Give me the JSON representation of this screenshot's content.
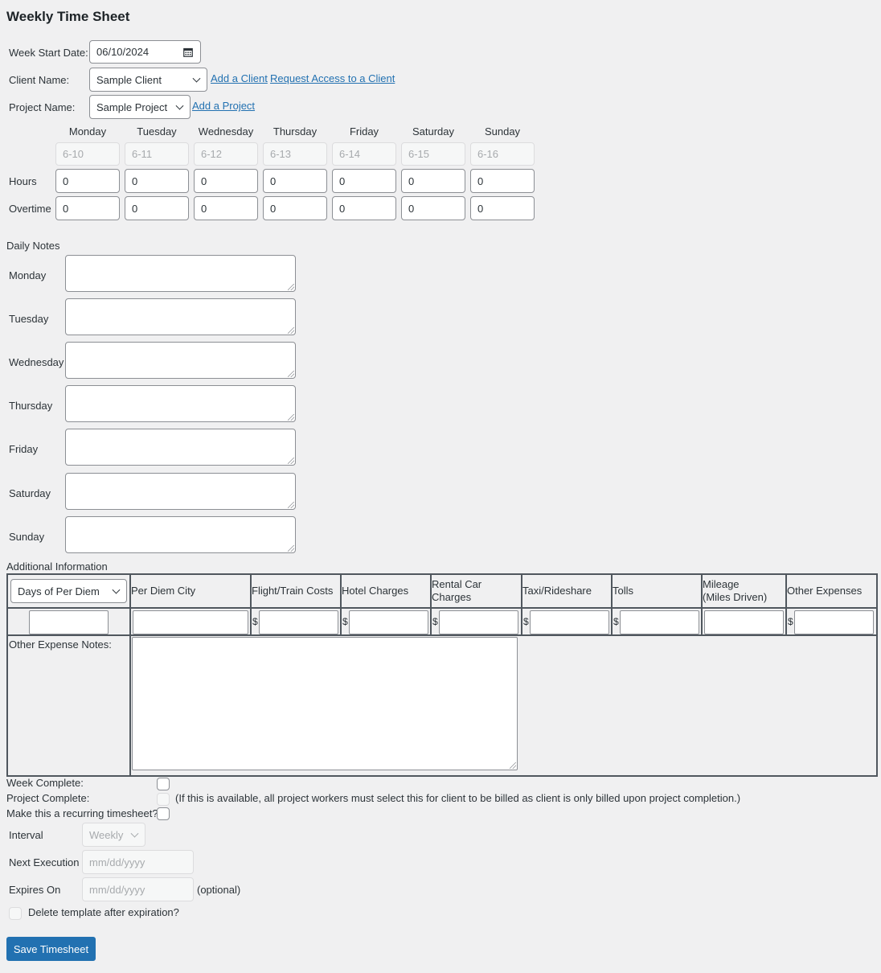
{
  "title": "Weekly Time Sheet",
  "week_start": {
    "label": "Week Start Date:",
    "value": "06/10/2024"
  },
  "client": {
    "label": "Client Name:",
    "selected": "Sample Client",
    "add_link": "Add a Client",
    "request_link": "Request Access to a Client"
  },
  "project": {
    "label": "Project Name:",
    "selected": "Sample Project",
    "add_link": "Add a Project"
  },
  "days": [
    {
      "name": "Monday",
      "date": "6-10",
      "hours": "0",
      "overtime": "0"
    },
    {
      "name": "Tuesday",
      "date": "6-11",
      "hours": "0",
      "overtime": "0"
    },
    {
      "name": "Wednesday",
      "date": "6-12",
      "hours": "0",
      "overtime": "0"
    },
    {
      "name": "Thursday",
      "date": "6-13",
      "hours": "0",
      "overtime": "0"
    },
    {
      "name": "Friday",
      "date": "6-14",
      "hours": "0",
      "overtime": "0"
    },
    {
      "name": "Saturday",
      "date": "6-15",
      "hours": "0",
      "overtime": "0"
    },
    {
      "name": "Sunday",
      "date": "6-16",
      "hours": "0",
      "overtime": "0"
    }
  ],
  "row_labels": {
    "hours": "Hours",
    "overtime": "Overtime"
  },
  "daily_notes": {
    "heading": "Daily Notes",
    "days": [
      "Monday",
      "Tuesday",
      "Wednesday",
      "Thursday",
      "Friday",
      "Saturday",
      "Sunday"
    ]
  },
  "additional": {
    "heading": "Additional Information",
    "per_diem_select": "Days of Per Diem",
    "columns": {
      "per_diem_city": "Per Diem City",
      "flight": "Flight/Train Costs",
      "hotel": "Hotel Charges",
      "rental": "Rental Car Charges",
      "taxi": "Taxi/Rideshare",
      "tolls": "Tolls",
      "mileage_line1": "Mileage",
      "mileage_line2": "(Miles Driven)",
      "other": "Other Expenses"
    },
    "currency": "$",
    "other_notes_label": "Other Expense Notes:"
  },
  "checkboxes": {
    "week_complete": "Week Complete:",
    "project_complete": "Project Complete:",
    "project_complete_note": "(If this is available, all project workers must select this for client to be billed as client is only billed upon project completion.)",
    "recurring": "Make this a recurring timesheet?"
  },
  "recurring": {
    "interval_label": "Interval",
    "interval_value": "Weekly",
    "next_label": "Next Execution",
    "next_placeholder": "mm/dd/yyyy",
    "expires_label": "Expires On",
    "expires_placeholder": "mm/dd/yyyy",
    "optional": "(optional)",
    "delete_label": "Delete template after expiration?"
  },
  "save_button": "Save Timesheet"
}
